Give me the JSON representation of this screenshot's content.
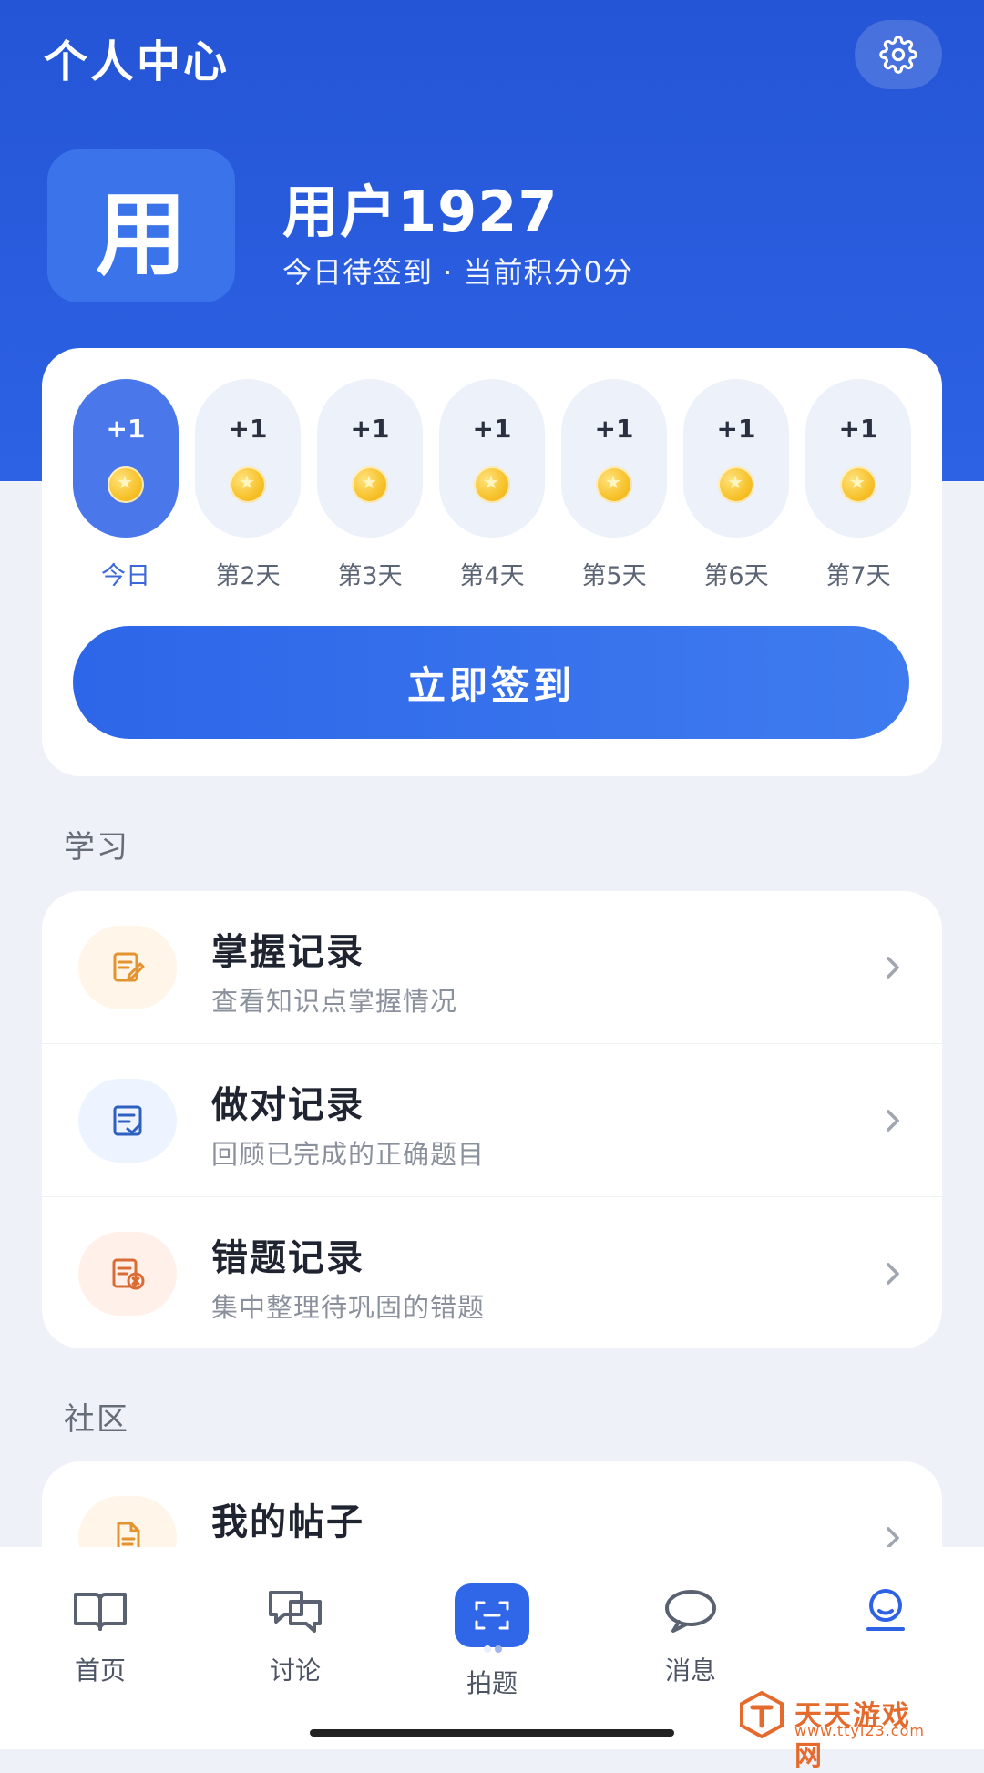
{
  "header": {
    "title": "个人中心",
    "settings_icon": "gear-icon"
  },
  "profile": {
    "avatar_text": "用",
    "username": "用户1927",
    "status": "今日待签到 · 当前积分0分"
  },
  "checkin": {
    "days": [
      {
        "reward": "+1",
        "label": "今日"
      },
      {
        "reward": "+1",
        "label": "第2天"
      },
      {
        "reward": "+1",
        "label": "第3天"
      },
      {
        "reward": "+1",
        "label": "第4天"
      },
      {
        "reward": "+1",
        "label": "第5天"
      },
      {
        "reward": "+1",
        "label": "第6天"
      },
      {
        "reward": "+1",
        "label": "第7天"
      }
    ],
    "button_label": "立即签到"
  },
  "sections": {
    "study_title": "学习",
    "community_title": "社区"
  },
  "study_items": [
    {
      "title": "掌握记录",
      "subtitle": "查看知识点掌握情况",
      "icon": "edit-note-icon"
    },
    {
      "title": "做对记录",
      "subtitle": "回顾已完成的正确题目",
      "icon": "check-doc-icon"
    },
    {
      "title": "错题记录",
      "subtitle": "集中整理待巩固的错题",
      "icon": "wrong-doc-icon"
    }
  ],
  "community_items": [
    {
      "title": "我的帖子",
      "icon": "post-doc-icon"
    }
  ],
  "bottom_nav": [
    {
      "label": "首页",
      "icon": "book-icon"
    },
    {
      "label": "讨论",
      "icon": "discussion-icon"
    },
    {
      "label": "拍题",
      "icon": "scan-icon"
    },
    {
      "label": "消息",
      "icon": "chat-icon"
    },
    {
      "label": "",
      "icon": "profile-icon"
    }
  ],
  "watermark": {
    "title": "天天游戏网",
    "url": "www.ttyl23.com"
  },
  "colors": {
    "primary": "#2d62e4",
    "accent": "#4a78ea",
    "background": "#eef1f7"
  }
}
